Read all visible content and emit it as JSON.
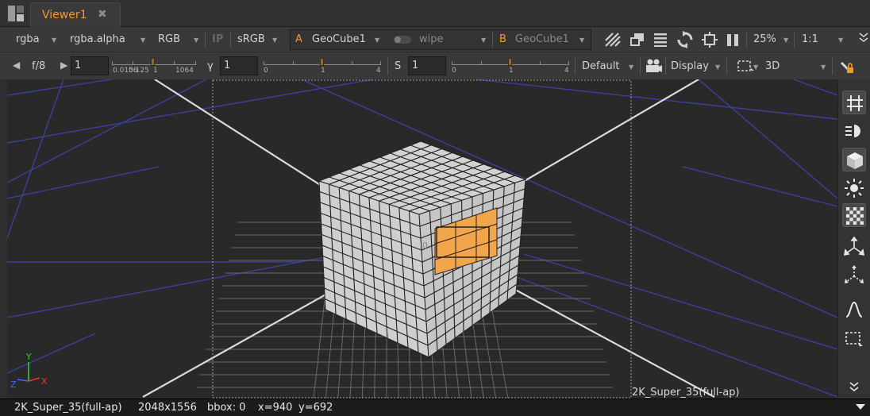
{
  "tab": {
    "title": "Viewer1",
    "close_glyph": "✖"
  },
  "toolbar1": {
    "channels": "rgba",
    "alpha_channel": "rgba.alpha",
    "display_channels": "RGB",
    "ip_label": "IP",
    "lut": "sRGB",
    "input_a_tag": "A",
    "input_a": "GeoCube1",
    "wipe": "wipe",
    "input_b_tag": "B",
    "input_b": "GeoCube1",
    "zoom": "25%",
    "proxy": "1:1"
  },
  "toolbar2": {
    "fstop": "f/8",
    "gain_value": "1",
    "gain_ticks": [
      "0.0156",
      "0.125",
      "1",
      "1064"
    ],
    "gamma_label": "γ",
    "gamma_value": "1",
    "gamma_ticks": [
      "0",
      "1",
      "4"
    ],
    "saturation_label": "S",
    "saturation_value": "1",
    "saturation_ticks": [
      "0",
      "1",
      "4"
    ],
    "input_process": "Default",
    "display": "Display",
    "view_mode": "3D"
  },
  "viewer": {
    "format_label": "2K_Super_35(full-ap)",
    "axis_y": "Y",
    "axis_x": "X",
    "axis_z": "Z",
    "cube_label": "0.",
    "colors": {
      "background": "#292929",
      "grid": "#3d3f9a",
      "axes": "#d9d9d9",
      "cube": "#d2d2d2",
      "selection": "#f2a54b",
      "accent": "#f29a2e"
    }
  },
  "sidebar": {
    "icons": [
      "grid-icon",
      "light-icon",
      "cube-icon",
      "sun-icon",
      "checkerboard-icon",
      "move-icon",
      "scale-icon",
      "curve-icon",
      "region-icon",
      "expand-icon"
    ]
  },
  "status": {
    "format": "2K_Super_35(full-ap)",
    "resolution": "2048x1556",
    "bbox": "bbox: 0",
    "x": "x=940",
    "y": "y=692"
  }
}
